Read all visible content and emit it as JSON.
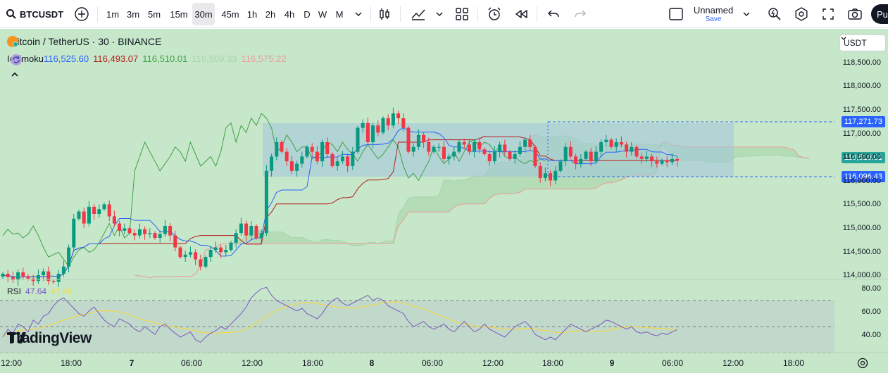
{
  "toolbar": {
    "symbol": "BTCUSDT",
    "timeframes": [
      "1m",
      "3m",
      "5m",
      "15m",
      "30m",
      "45m",
      "1h",
      "2h",
      "4h",
      "D",
      "W",
      "M"
    ],
    "active_timeframe": "30m",
    "layout_name": "Unnamed",
    "save_label": "Save",
    "publish_label": "Pu"
  },
  "legend": {
    "title": "Bitcoin / TetherUS · 30 · BINANCE",
    "ichimoku": {
      "label": "Ichimoku",
      "values": [
        "116,525.60",
        "116,493.07",
        "116,510.01",
        "116,509.33",
        "116,575.22"
      ],
      "colors": [
        "#2962ff",
        "#b71c1c",
        "#43a047",
        "#a5d6a7",
        "#ef9a9a"
      ]
    },
    "rsi": {
      "label": "RSI",
      "values": [
        "47.64",
        "47.45"
      ],
      "colors": [
        "#7e57c2",
        "#fdd835"
      ]
    }
  },
  "currency_select": "USDT",
  "price_tags": {
    "upper": "117,271.73",
    "last": "116,510.01",
    "lower": "116,096.43"
  },
  "watermark": "TradingView",
  "chart_data": {
    "type": "candlestick",
    "symbol": "BTCUSDT",
    "exchange": "BINANCE",
    "interval": "30",
    "price_axis": {
      "ticks": [
        "118,500.00",
        "118,000.00",
        "117,500.00",
        "117,000.00",
        "116,500.00",
        "116,000.00",
        "115,500.00",
        "115,000.00",
        "114,500.00",
        "114,000.00"
      ],
      "range": [
        113900,
        118900
      ]
    },
    "rsi_axis": {
      "ticks": [
        "80.00",
        "60.00",
        "40.00"
      ],
      "range": [
        28,
        84
      ]
    },
    "time_axis": {
      "ticks": [
        "12:00",
        "18:00",
        "7",
        "06:00",
        "12:00",
        "18:00",
        "8",
        "06:00",
        "12:00",
        "18:00",
        "9",
        "06:00",
        "12:00",
        "18:00"
      ],
      "bold_ticks": [
        "7",
        "8",
        "9"
      ]
    },
    "closes": [
      114150,
      114080,
      114020,
      114180,
      114100,
      114050,
      114000,
      114120,
      114200,
      114000,
      113980,
      114150,
      114300,
      114700,
      115300,
      115450,
      115200,
      115550,
      115400,
      115500,
      115600,
      115350,
      115200,
      115050,
      115100,
      115000,
      114950,
      115080,
      114980,
      115000,
      114900,
      114980,
      115150,
      114950,
      114700,
      114500,
      114550,
      114600,
      114450,
      114300,
      114500,
      114650,
      114700,
      114600,
      114650,
      114800,
      115000,
      115200,
      114950,
      115150,
      114900,
      115000,
      116300,
      116600,
      116900,
      116700,
      116500,
      116300,
      116450,
      116600,
      116800,
      116700,
      116500,
      116900,
      116650,
      116400,
      116500,
      116600,
      116400,
      116700,
      117200,
      117300,
      116900,
      117250,
      117100,
      117400,
      117250,
      117500,
      117400,
      117200,
      116700,
      116800,
      117050,
      116900,
      116700,
      116800,
      116800,
      116550,
      116600,
      116700,
      116900,
      116850,
      116700,
      116900,
      116750,
      116650,
      116500,
      116700,
      116850,
      116700,
      116550,
      116650,
      116800,
      116950,
      116800,
      116400,
      116150,
      116250,
      116100,
      116300,
      116500,
      116800,
      116600,
      116450,
      116550,
      116700,
      116500,
      116700,
      116900,
      116950,
      116800,
      116900,
      116850,
      116700,
      116800,
      116600,
      116550,
      116600,
      116500,
      116450,
      116520,
      116480,
      116550,
      116510
    ],
    "rsi": [
      42,
      48,
      45,
      52,
      50,
      46,
      55,
      52,
      58,
      60,
      66,
      70,
      72,
      68,
      64,
      60,
      58,
      62,
      65,
      60,
      55,
      52,
      50,
      56,
      54,
      52,
      48,
      46,
      50,
      47,
      44,
      50,
      52,
      48,
      45,
      42,
      44,
      46,
      40,
      38,
      42,
      45,
      47,
      50,
      48,
      52,
      56,
      60,
      65,
      72,
      76,
      79,
      80,
      74,
      70,
      68,
      66,
      64,
      62,
      64,
      60,
      58,
      56,
      60,
      66,
      70,
      72,
      68,
      66,
      68,
      70,
      72,
      74,
      70,
      72,
      70,
      66,
      64,
      62,
      60,
      54,
      50,
      52,
      54,
      50,
      48,
      50,
      52,
      48,
      46,
      50,
      54,
      50,
      46,
      48,
      52,
      48,
      46,
      44,
      42,
      46,
      50,
      52,
      54,
      50,
      44,
      42,
      40,
      42,
      40,
      44,
      48,
      52,
      50,
      48,
      46,
      48,
      50,
      52,
      55,
      54,
      52,
      50,
      48,
      50,
      46,
      45,
      46,
      44,
      43,
      45,
      44,
      46,
      47.64
    ]
  }
}
